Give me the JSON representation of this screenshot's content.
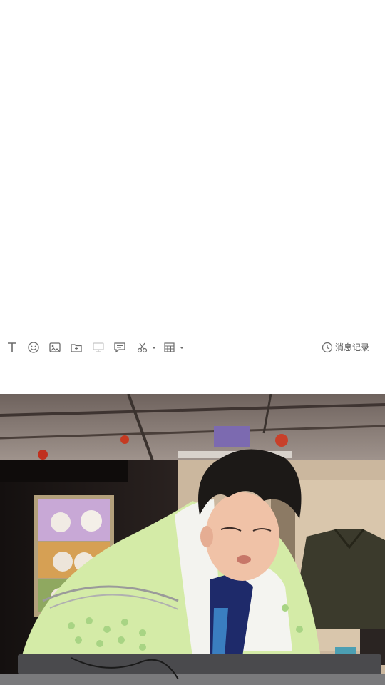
{
  "toolbar": {
    "icons": [
      "text-format-icon",
      "emoji-icon",
      "image-icon",
      "folder-icon",
      "screen-share-icon",
      "chat-bubble-icon",
      "scissors-icon",
      "calendar-grid-icon"
    ],
    "history_label": "消息记录"
  },
  "colors": {
    "toolbar_icon": "#6b6b6b",
    "toolbar_icon_disabled": "#c8c8c8",
    "blanket_green": "#cfe8a0",
    "hair": "#1c1917"
  },
  "video": {
    "description_icon": "video-frame"
  }
}
